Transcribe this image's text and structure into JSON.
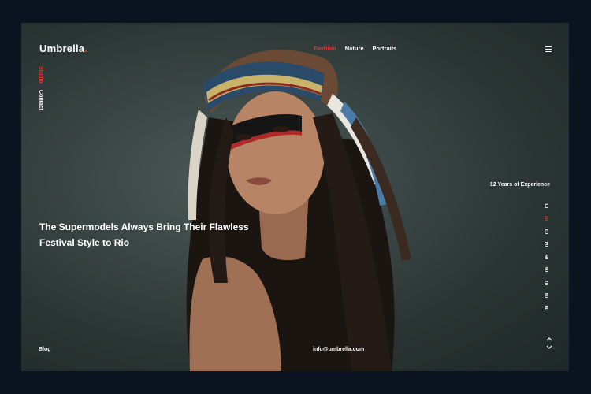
{
  "brand": {
    "name": "Umbrella",
    "dot": ".",
    "accent": "#e53935"
  },
  "top_nav": [
    {
      "label": "Fashion",
      "active": true
    },
    {
      "label": "Nature",
      "active": false
    },
    {
      "label": "Portraits",
      "active": false
    }
  ],
  "side_nav": [
    {
      "label": "Studio",
      "active": true
    },
    {
      "label": "Contact",
      "active": false
    }
  ],
  "hero": {
    "headline_line1": "The Supermodels Always Bring Their Flawless",
    "headline_line2": "Festival Style to Rio"
  },
  "experience_label": "12 Years of Experience",
  "pager": [
    "01",
    "02",
    "03",
    "04",
    "05",
    "06",
    "07",
    "08",
    "09"
  ],
  "pager_active": "02",
  "footer": {
    "blog": "Blog",
    "email": "info@umbrella.com"
  },
  "icons": {
    "menu": "hamburger-icon",
    "up": "chevron-up-icon",
    "down": "chevron-down-icon"
  }
}
